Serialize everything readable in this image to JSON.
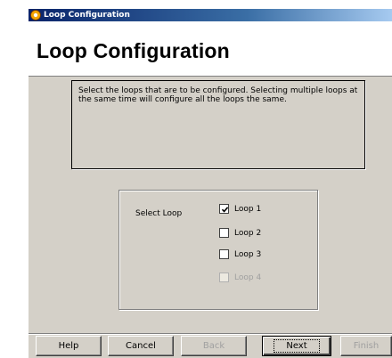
{
  "window": {
    "title": "Loop Configuration"
  },
  "header": {
    "title": "Loop Configuration"
  },
  "description": "Select the loops that are to be configured. Selecting multiple loops at the same time will configure all the loops the same.",
  "select_loop": {
    "label": "Select Loop",
    "options": [
      {
        "label": "Loop 1",
        "checked": true,
        "enabled": true
      },
      {
        "label": "Loop 2",
        "checked": false,
        "enabled": true
      },
      {
        "label": "Loop 3",
        "checked": false,
        "enabled": true
      },
      {
        "label": "Loop 4",
        "checked": false,
        "enabled": false
      }
    ]
  },
  "buttons": {
    "help": "Help",
    "cancel": "Cancel",
    "back": "Back",
    "next": "Next",
    "finish": "Finish"
  }
}
